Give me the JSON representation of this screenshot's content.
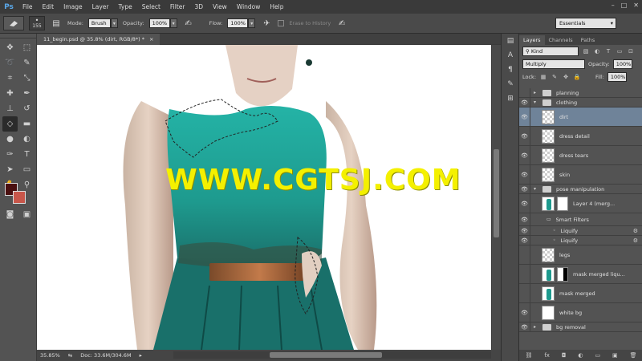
{
  "app": {
    "logo": "Ps"
  },
  "menu": [
    "File",
    "Edit",
    "Image",
    "Layer",
    "Type",
    "Select",
    "Filter",
    "3D",
    "View",
    "Window",
    "Help"
  ],
  "window_controls": [
    "–",
    "□",
    "✕"
  ],
  "options": {
    "brush_size": "155",
    "mode_label": "Mode:",
    "mode_value": "Brush",
    "opacity_label": "Opacity:",
    "opacity_value": "100%",
    "flow_label": "Flow:",
    "flow_value": "100%",
    "erase_history": "Erase to History",
    "workspace": "Essentials"
  },
  "document": {
    "tab": "11_begin.psd @ 35.8% (dirt, RGB/8*) *",
    "tab_close": "×",
    "zoom": "35.85%",
    "doc_size": "Doc: 33.6M/304.6M",
    "watermark": "WWW.CGTSJ.COM"
  },
  "layers_panel": {
    "tabs": [
      "Layers",
      "Channels",
      "Paths"
    ],
    "kind": "Kind",
    "blend_mode": "Multiply",
    "opacity_label": "Opacity:",
    "opacity_value": "100%",
    "lock_label": "Lock:",
    "fill_label": "Fill:",
    "fill_value": "100%",
    "layers": [
      {
        "name": "planning",
        "type": "group",
        "visible": false,
        "expanded": false,
        "indent": 0
      },
      {
        "name": "clothing",
        "type": "group",
        "visible": true,
        "expanded": true,
        "indent": 0
      },
      {
        "name": "dirt",
        "type": "layer",
        "visible": true,
        "selected": true,
        "indent": 1
      },
      {
        "name": "dress detail",
        "type": "layer",
        "visible": true,
        "indent": 1
      },
      {
        "name": "dress tears",
        "type": "layer",
        "visible": true,
        "indent": 1
      },
      {
        "name": "skin",
        "type": "layer",
        "visible": true,
        "indent": 1
      },
      {
        "name": "pose manipulation",
        "type": "group",
        "visible": true,
        "expanded": true,
        "indent": 0
      },
      {
        "name": "Layer 4 (merg...",
        "type": "smart",
        "visible": true,
        "indent": 1
      },
      {
        "name": "Smart Filters",
        "type": "filters",
        "visible": true,
        "indent": 2
      },
      {
        "name": "Liquify",
        "type": "filter",
        "visible": true,
        "indent": 3
      },
      {
        "name": "Liquify",
        "type": "filter",
        "visible": true,
        "indent": 3
      },
      {
        "name": "legs",
        "type": "layer",
        "visible": false,
        "indent": 1
      },
      {
        "name": "mask merged liqu...",
        "type": "masked",
        "visible": false,
        "indent": 1
      },
      {
        "name": "mask merged",
        "type": "figure",
        "visible": false,
        "indent": 1
      },
      {
        "name": "white bg",
        "type": "white",
        "visible": true,
        "indent": 1
      },
      {
        "name": "bg removal",
        "type": "group",
        "visible": true,
        "expanded": false,
        "indent": 0
      }
    ],
    "footer_icons": [
      "link-icon",
      "fx-icon",
      "mask-icon",
      "adjustment-icon",
      "group-icon",
      "new-layer-icon",
      "trash-icon"
    ]
  },
  "colors": {
    "foreground": "#4a1010",
    "background": "#c8564a",
    "dress": "#1e9a8e",
    "selection": "#6f8399"
  }
}
